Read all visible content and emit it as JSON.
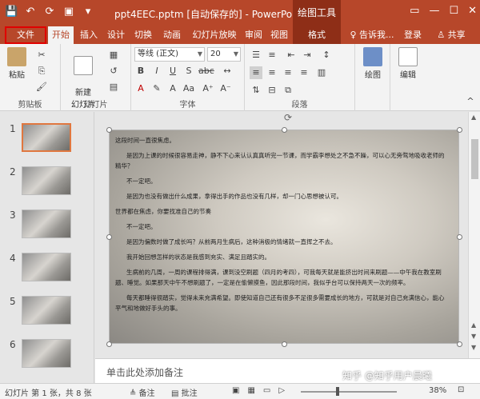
{
  "titlebar": {
    "qat": [
      "💾",
      "↶",
      "⟳",
      "▣",
      "▾"
    ],
    "window_title": "ppt4EEC.pptm [自动保存的] - PowerPoint",
    "context_tools": "绘图工具",
    "window_controls": [
      "▭",
      "—",
      "☐",
      "✕"
    ]
  },
  "tabs": {
    "file": "文件",
    "home": "开始",
    "insert": "插入",
    "design": "设计",
    "transitions": "切换",
    "animations": "动画",
    "slideshow": "幻灯片放映",
    "review": "审阅",
    "view": "视图",
    "format": "格式",
    "tellme": "♀ 告诉我...",
    "signin": "登录",
    "share": "♙ 共享"
  },
  "ribbon": {
    "clipboard": {
      "paste": "粘贴",
      "group": "剪贴板"
    },
    "slides": {
      "new_slide": "新建\n幻灯片",
      "group": "幻灯片"
    },
    "font": {
      "family": "等线 (正文)",
      "size": "20",
      "group": "字体"
    },
    "paragraph": {
      "group": "段落"
    },
    "drawing": {
      "label": "绘图"
    },
    "editing": {
      "label": "编辑"
    }
  },
  "thumbnails": [
    "1",
    "2",
    "3",
    "4",
    "5",
    "6"
  ],
  "slide": {
    "paragraphs": [
      "这段时间一直很焦虑。",
      "是因为上课的时候很容易走神，静不下心来认认真真听完一节课，而学霸李想处之不急不躁，可以心无旁骛地吸收老师的精华？",
      "不一定吧。",
      "是因为也没有做出什么成果，拿得出手的作品也没有几样，却一门心思想被认可。",
      "世界都在焦虑，你要找准自己的节奏",
      "不一定吧。",
      "是因为偏数时做了成长吗？从前两月生病后，这种消极的情绪就一直挥之不去。",
      "我开始回想怎样的状态是我感到充实、满足且踏实的。",
      "生病前的几周，一周的课程排得满，课到没空刷题（四月的考四），可我每天就是能挤出时间来刷题——中午我在教室刷题、睡觉。如果那天中午不想刷题了，一定是在偷懒摸鱼，因此那段时间，我似乎台可以保持两天一次的频率。",
      "每天都睡得很踏实，觉得未来充满希望。即使知道自己还有很多不足很多需要成长的地方，可就是对自己充满信心，能心平气和地做好手头的事。"
    ]
  },
  "notes": {
    "placeholder": "单击此处添加备注"
  },
  "status": {
    "slide_info": "幻灯片 第 1 张，共 8 张",
    "notes": "≜ 备注",
    "comments": "▤ 批注",
    "zoom": "38%"
  },
  "watermark": "知乎 @知乎用户晨曦"
}
